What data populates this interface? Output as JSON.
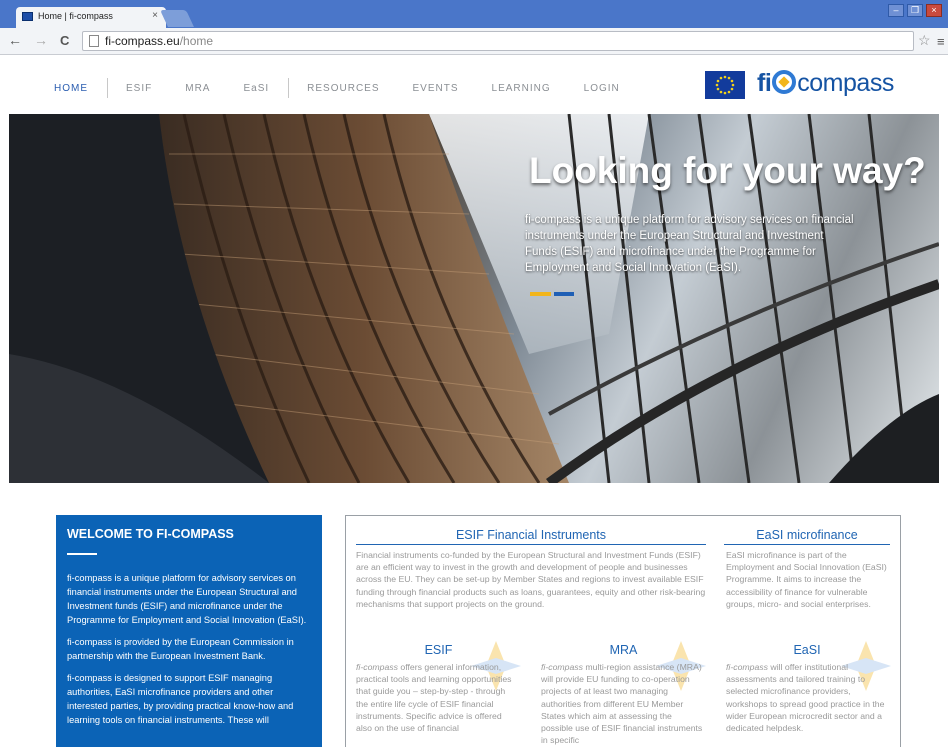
{
  "browser": {
    "tab_title": "Home | fi-compass",
    "tab_close": "×",
    "url_host": "fi-compass.eu",
    "url_path": "/home",
    "back_glyph": "←",
    "forward_glyph": "→",
    "reload_glyph": "C",
    "star_glyph": "☆",
    "menu_glyph": "≡",
    "window_buttons": [
      "–",
      "❐",
      "×"
    ]
  },
  "nav": {
    "items": [
      "HOME",
      "ESIF",
      "MRA",
      "EaSI",
      "RESOURCES",
      "EVENTS",
      "LEARNING",
      "LOGIN"
    ],
    "active": "HOME"
  },
  "brand": {
    "prefix": "fi",
    "suffix": "compass"
  },
  "hero": {
    "title": "Looking for your way?",
    "text": "fi-compass is a unique platform for advisory services on financial instruments under the European Structural and Investment Funds (ESIF) and microfinance under the Programme for Employment and Social Innovation (EaSI).",
    "bar_colors": [
      "#f2b51b",
      "#1f5fb5"
    ]
  },
  "welcome": {
    "title": "WELCOME TO FI-COMPASS",
    "paragraphs": [
      "fi-compass is a unique platform for advisory services on financial instruments under the European Structural and Investment funds (ESIF) and microfinance under the Programme for Employment and Social Innovation (EaSI).",
      "fi-compass is provided by the European Commission in partnership with the European Investment Bank.",
      "fi-compass is designed to support ESIF managing authorities, EaSI microfinance providers and other interested parties, by providing practical know-how and learning tools on financial instruments. These will"
    ]
  },
  "esif_fi": {
    "title": "ESIF Financial Instruments",
    "text": "Financial instruments co-funded by the European Structural and Investment Funds (ESIF) are an efficient way to invest in the growth and development of people and businesses across the EU. They can be set-up by Member States and regions to invest available ESIF funding through financial products such as loans, guarantees, equity and other risk-bearing mechanisms that support projects on the ground."
  },
  "easi_micro": {
    "title": "EaSI microfinance",
    "text": "EaSI microfinance is part of the Employment and Social Innovation (EaSI) Programme. It aims to increase the accessibility of finance for vulnerable groups, micro- and social enterprises."
  },
  "esif": {
    "title": "ESIF",
    "brand": "fi-compass",
    "text": " offers general information, practical tools and learning opportunities that guide you – step-by-step - through the entire life cycle of ESIF financial instruments. Specific advice is offered also on the use of financial"
  },
  "mra": {
    "title": "MRA",
    "brand": "fi-compass",
    "text": " multi-region assistance (MRA) will provide EU funding to co-operation projects of at least two managing authorities from different EU Member States which aim at assessing the possible use of ESIF financial instruments in specific"
  },
  "easi": {
    "title": "EaSI",
    "brand": "fi-compass",
    "text": " will offer institutional assessments and tailored training to selected microfinance providers, workshops to spread good practice in the wider European microcredit sector and a  dedicated helpdesk."
  },
  "colors": {
    "brand_blue": "#0b63b6",
    "title_blue": "#2065b3",
    "tab_bar": "#4a76c9"
  }
}
